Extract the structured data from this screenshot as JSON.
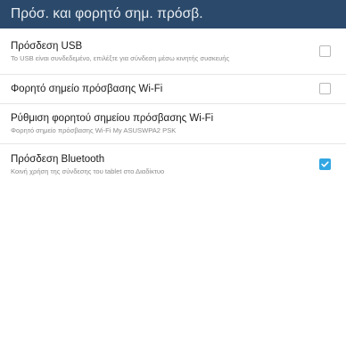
{
  "header": {
    "title": "Πρόσ. και φορητό σημ. πρόσβ."
  },
  "settings": [
    {
      "title": "Πρόσδεση USB",
      "summary": "Το USB είναι συνδεδεμένο, επιλέξτε για σύνδεση μέσω κινητής συσκευής",
      "checked": false
    },
    {
      "title": "Φορητό σημείο πρόσβασης Wi-Fi",
      "summary": "",
      "checked": false
    },
    {
      "title": "Ρύθμιση φορητού σημείου πρόσβασης Wi-Fi",
      "summary": "Φορητό σημείο πρόσβασης Wi-Fi My ASUSWPA2 PSK",
      "checked": null
    },
    {
      "title": "Πρόσδεση Bluetooth",
      "summary": "Κοινή χρήση της σύνδεσης του tablet στο Διαδίκτυο",
      "checked": true
    }
  ],
  "colors": {
    "action_bar": "#2b4a6b",
    "accent": "#33a7e3"
  }
}
